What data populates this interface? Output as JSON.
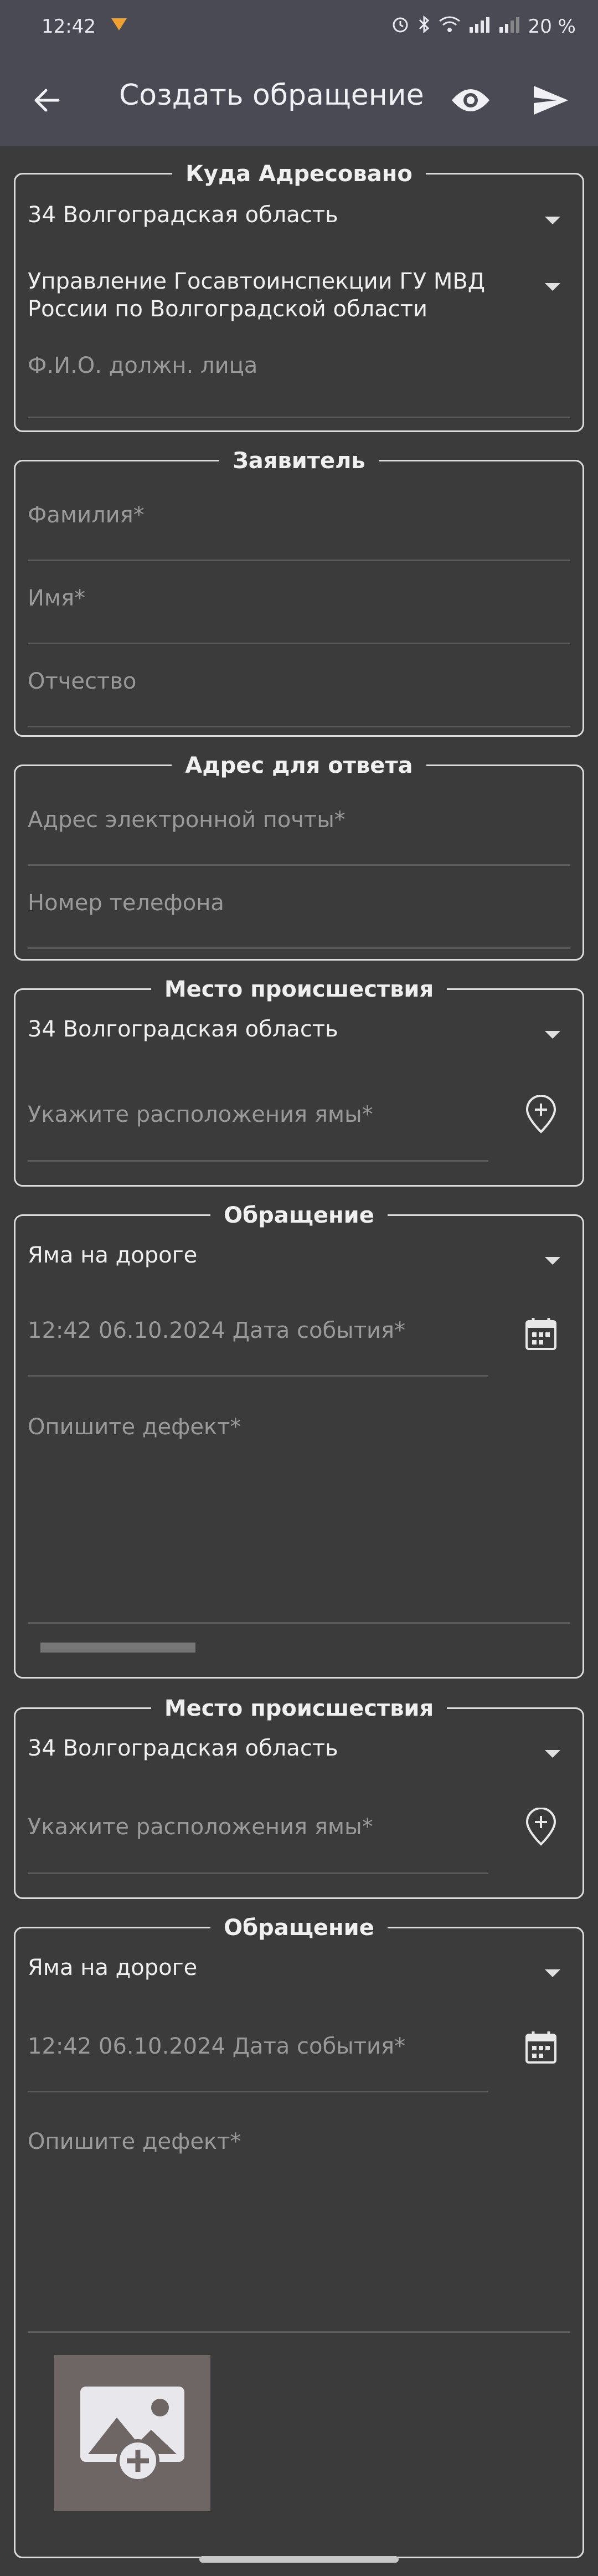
{
  "status_bar": {
    "time": "12:42",
    "battery": "20 %"
  },
  "toolbar": {
    "title": "Создать обращение"
  },
  "address_to": {
    "title": "Куда Адресовано",
    "region": "34 Волгоградская область",
    "department": "Управление Госавтоинспекции ГУ МВД России по Волгоградской области",
    "official_placeholder": "Ф.И.О. должн. лица"
  },
  "applicant": {
    "title": "Заявитель",
    "last_name_placeholder": "Фамилия*",
    "first_name_placeholder": "Имя*",
    "middle_name_placeholder": "Отчество"
  },
  "reply_address": {
    "title": "Адрес для ответа",
    "email_placeholder": "Адрес электронной почты*",
    "phone_placeholder": "Номер телефона"
  },
  "incident_place_1": {
    "title": "Место происшествия",
    "region": "34 Волгоградская область",
    "location_placeholder": "Укажите расположения ямы*"
  },
  "appeal_1": {
    "title": "Обращение",
    "type": "Яма на дороге",
    "date_placeholder": "12:42 06.10.2024 Дата события*",
    "defect_placeholder": "Опишите дефект*"
  },
  "incident_place_2": {
    "title": "Место происшествия",
    "region": "34 Волгоградская область",
    "location_placeholder": "Укажите расположения ямы*"
  },
  "appeal_2": {
    "title": "Обращение",
    "type": "Яма на дороге",
    "date_placeholder": "12:42 06.10.2024 Дата события*",
    "defect_placeholder": "Опишите дефект*"
  },
  "icons": {
    "back": "arrow-left-icon",
    "preview": "eye-icon",
    "send": "send-icon",
    "location": "add-location-icon",
    "calendar": "calendar-icon",
    "add_photo": "add-photo-icon"
  }
}
